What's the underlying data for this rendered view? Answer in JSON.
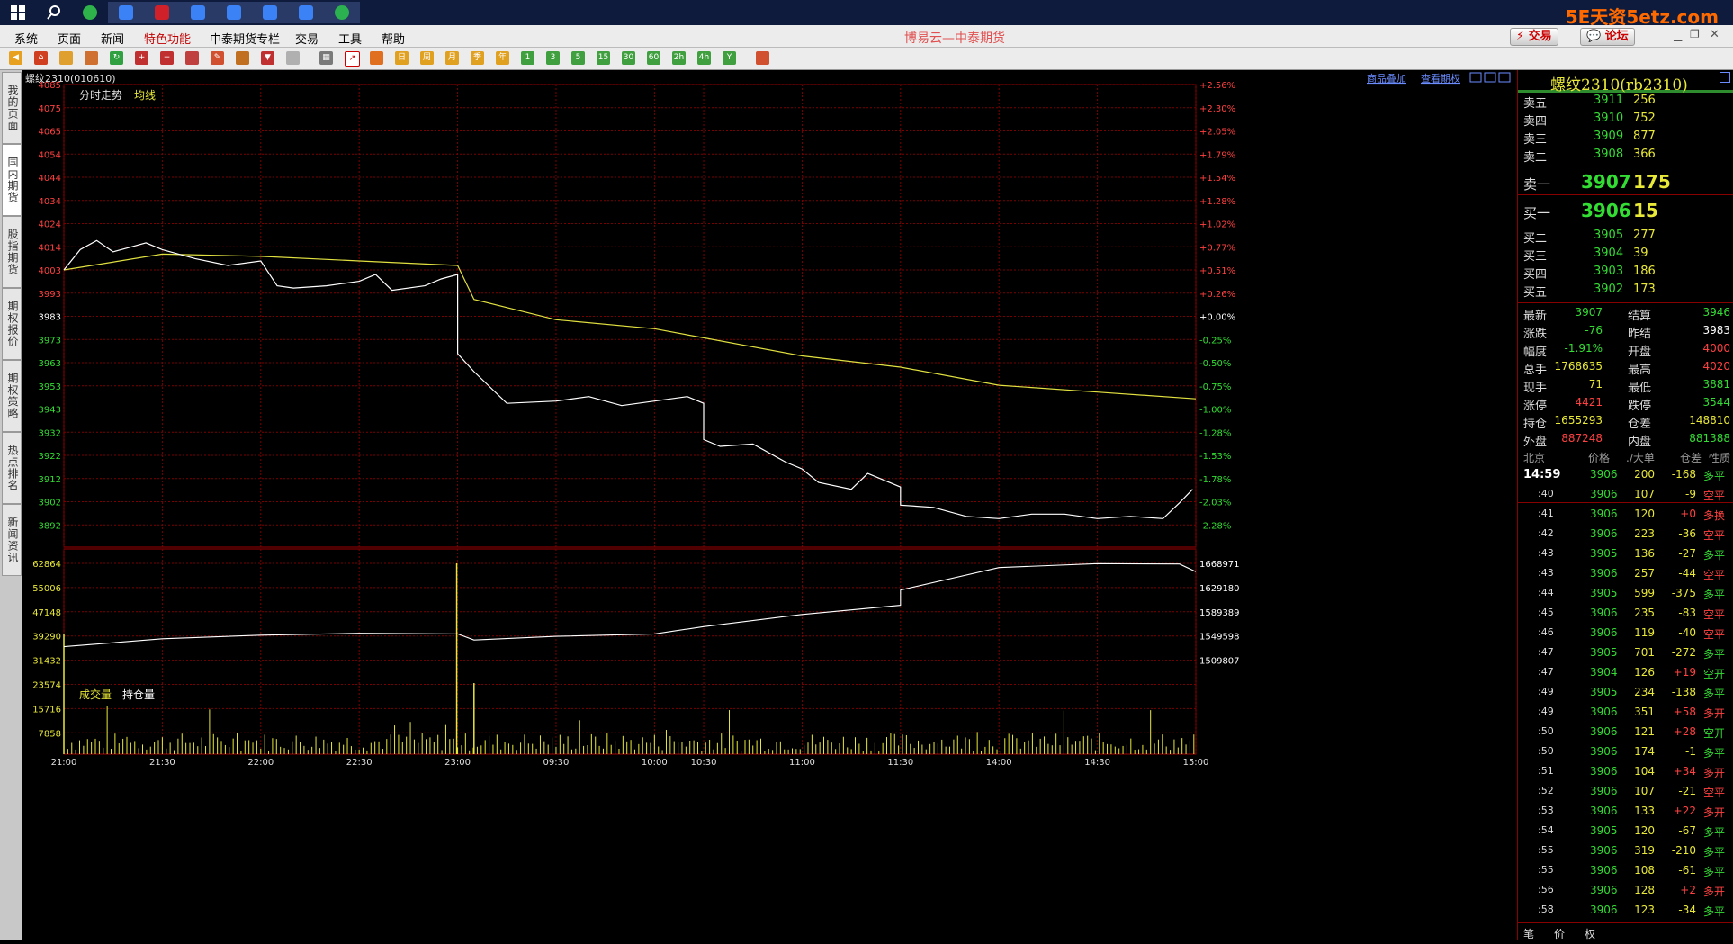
{
  "brand": "5E天资5etz.com",
  "menubar": {
    "items": [
      "系统",
      "页面",
      "新闻",
      "特色功能",
      "中泰期货专栏",
      "交易",
      "工具",
      "帮助"
    ],
    "title": "博易云—中泰期货",
    "trade_btn": "交易",
    "forum_btn": "论坛"
  },
  "left_nav": [
    "我的页面",
    "国内期货",
    "股指期货",
    "期权报价",
    "期权策略",
    "热点排名",
    "新闻资讯"
  ],
  "chart_header": {
    "symbol": "螺纹2310(010610)",
    "overlay_link": "商品叠加",
    "options_link": "查看期权"
  },
  "price_panel": {
    "label": "分时走势",
    "avg_label": "均线",
    "left_ticks": [
      "4085",
      "4075",
      "4065",
      "4054",
      "4044",
      "4034",
      "4024",
      "4014",
      "4003",
      "3993",
      "3983",
      "3973",
      "3963",
      "3953",
      "3943",
      "3932",
      "3922",
      "3912",
      "3902",
      "3892"
    ],
    "right_ticks": [
      "+2.56%",
      "+2.30%",
      "+2.05%",
      "+1.79%",
      "+1.54%",
      "+1.28%",
      "+1.02%",
      "+0.77%",
      "+0.51%",
      "+0.26%",
      "+0.00%",
      "-0.25%",
      "-0.50%",
      "-0.75%",
      "-1.00%",
      "-1.28%",
      "-1.53%",
      "-1.78%",
      "-2.03%",
      "-2.28%"
    ],
    "ymax": 4085,
    "ystep": 10.25,
    "price_color": "#ffffff",
    "avg_color": "#e0e040"
  },
  "volume_panel": {
    "vol_label": "成交量",
    "oi_label": "持仓量",
    "left_ticks": [
      "62864",
      "55006",
      "47148",
      "39290",
      "31432",
      "23574",
      "15716",
      "7858"
    ],
    "right_ticks": [
      "1668971",
      "1629180",
      "1589389",
      "1549598",
      "1509807"
    ],
    "vol_color": "#e8e838"
  },
  "time_axis": [
    "21:00",
    "21:30",
    "22:00",
    "22:30",
    "23:00",
    "09:30",
    "10:00",
    "10:30",
    "11:00",
    "11:30",
    "14:00",
    "14:30",
    "15:00"
  ],
  "chart_data": {
    "type": "line",
    "title": "螺纹2310(010610)",
    "xlabel": "",
    "ylabel": "",
    "ylim": [
      3887,
      4090
    ],
    "series": [
      {
        "name": "分时走势",
        "x": [
          "21:00",
          "21:05",
          "21:10",
          "21:15",
          "21:20",
          "21:25",
          "21:30",
          "21:40",
          "21:50",
          "22:00",
          "22:05",
          "22:10",
          "22:20",
          "22:30",
          "22:35",
          "22:40",
          "22:50",
          "22:55",
          "23:00",
          "09:00",
          "09:05",
          "09:15",
          "09:30",
          "09:40",
          "09:50",
          "10:00",
          "10:10",
          "10:15",
          "10:30",
          "10:35",
          "10:45",
          "10:55",
          "11:00",
          "11:05",
          "11:15",
          "11:20",
          "11:30",
          "13:30",
          "13:40",
          "13:50",
          "14:00",
          "14:10",
          "14:20",
          "14:30",
          "14:40",
          "14:50",
          "14:55",
          "14:59"
        ],
        "values": [
          4003,
          4012,
          4016,
          4011,
          4013,
          4015,
          4012,
          4008,
          4005,
          4007,
          3996,
          3995,
          3996,
          3998,
          4001,
          3994,
          3996,
          3999,
          4001,
          3966,
          3958,
          3944,
          3945,
          3947,
          3943,
          3945,
          3947,
          3944,
          3928,
          3925,
          3926,
          3918,
          3915,
          3909,
          3906,
          3913,
          3907,
          3899,
          3898,
          3894,
          3893,
          3895,
          3895,
          3893,
          3894,
          3893,
          3900,
          3906
        ]
      },
      {
        "name": "均线",
        "x": [
          "21:00",
          "21:30",
          "22:00",
          "22:30",
          "23:00",
          "09:05",
          "09:30",
          "10:00",
          "10:30",
          "11:00",
          "11:30",
          "14:00",
          "14:30",
          "15:00"
        ],
        "values": [
          4003,
          4010,
          4009,
          4007,
          4005,
          3990,
          3981,
          3977,
          3973,
          3965,
          3960,
          3952,
          3949,
          3946
        ]
      },
      {
        "name": "持仓量",
        "x": [
          "21:00",
          "21:30",
          "22:00",
          "22:30",
          "23:00",
          "09:05",
          "09:30",
          "10:00",
          "10:30",
          "11:00",
          "11:30",
          "13:30",
          "14:00",
          "14:30",
          "14:55",
          "15:00"
        ],
        "values": [
          1532000,
          1545000,
          1551000,
          1554000,
          1553000,
          1543000,
          1549000,
          1553000,
          1565000,
          1585000,
          1600000,
          1625000,
          1662000,
          1668500,
          1668000,
          1655293
        ]
      }
    ],
    "volume": {
      "peaks": [
        {
          "time": "23:00",
          "value": 62864
        },
        {
          "time": "21:00",
          "value": 40000
        },
        {
          "time": "09:05",
          "value": 24000
        }
      ],
      "typical": 7858
    }
  },
  "quote": {
    "title": "螺纹2310(rb2310)",
    "asks": [
      {
        "label": "卖五",
        "price": "3911",
        "vol": "256"
      },
      {
        "label": "卖四",
        "price": "3910",
        "vol": "752"
      },
      {
        "label": "卖三",
        "price": "3909",
        "vol": "877"
      },
      {
        "label": "卖二",
        "price": "3908",
        "vol": "366"
      },
      {
        "label": "卖一",
        "price": "3907",
        "vol": "175"
      }
    ],
    "bids": [
      {
        "label": "买一",
        "price": "3906",
        "vol": "15"
      },
      {
        "label": "买二",
        "price": "3905",
        "vol": "277"
      },
      {
        "label": "买三",
        "price": "3904",
        "vol": "39"
      },
      {
        "label": "买四",
        "price": "3903",
        "vol": "186"
      },
      {
        "label": "买五",
        "price": "3902",
        "vol": "173"
      }
    ],
    "stats": [
      {
        "l1": "最新",
        "v1": "3907",
        "c1": "#33dd33",
        "l2": "结算",
        "v2": "3946",
        "c2": "#33dd33"
      },
      {
        "l1": "涨跌",
        "v1": "-76",
        "c1": "#33dd33",
        "l2": "昨结",
        "v2": "3983",
        "c2": "#ffffff"
      },
      {
        "l1": "幅度",
        "v1": "-1.91%",
        "c1": "#33dd33",
        "l2": "开盘",
        "v2": "4000",
        "c2": "#ff4040"
      },
      {
        "l1": "总手",
        "v1": "1768635",
        "c1": "#e8e838",
        "l2": "最高",
        "v2": "4020",
        "c2": "#ff4040"
      },
      {
        "l1": "现手",
        "v1": "71",
        "c1": "#e8e838",
        "l2": "最低",
        "v2": "3881",
        "c2": "#33dd33"
      },
      {
        "l1": "涨停",
        "v1": "4421",
        "c1": "#ff4040",
        "l2": "跌停",
        "v2": "3544",
        "c2": "#33dd33"
      },
      {
        "l1": "持仓",
        "v1": "1655293",
        "c1": "#e8e838",
        "l2": "仓差",
        "v2": "148810",
        "c2": "#e8e838"
      },
      {
        "l1": "外盘",
        "v1": "887248",
        "c1": "#ff4040",
        "l2": "内盘",
        "v2": "881388",
        "c2": "#33dd33"
      }
    ],
    "tick_header": [
      "北京",
      "价格",
      "./大单",
      "仓差",
      "性质"
    ],
    "ticks": [
      {
        "t": "14:59",
        "p": "3906",
        "v": "200",
        "d": "-168",
        "k": "多平",
        "kc": "#33dd33"
      },
      {
        "t": ":40",
        "p": "3906",
        "v": "107",
        "d": "-9",
        "k": "空平",
        "kc": "#ff4040"
      },
      {
        "t": ":41",
        "p": "3906",
        "v": "120",
        "d": "+0",
        "k": "多换",
        "kc": "#ff4040"
      },
      {
        "t": ":42",
        "p": "3906",
        "v": "223",
        "d": "-36",
        "k": "空平",
        "kc": "#ff4040"
      },
      {
        "t": ":43",
        "p": "3905",
        "v": "136",
        "d": "-27",
        "k": "多平",
        "kc": "#33dd33"
      },
      {
        "t": ":43",
        "p": "3906",
        "v": "257",
        "d": "-44",
        "k": "空平",
        "kc": "#ff4040"
      },
      {
        "t": ":44",
        "p": "3905",
        "v": "599",
        "d": "-375",
        "k": "多平",
        "kc": "#33dd33"
      },
      {
        "t": ":45",
        "p": "3906",
        "v": "235",
        "d": "-83",
        "k": "空平",
        "kc": "#ff4040"
      },
      {
        "t": ":46",
        "p": "3906",
        "v": "119",
        "d": "-40",
        "k": "空平",
        "kc": "#ff4040"
      },
      {
        "t": ":47",
        "p": "3905",
        "v": "701",
        "d": "-272",
        "k": "多平",
        "kc": "#33dd33"
      },
      {
        "t": ":47",
        "p": "3904",
        "v": "126",
        "d": "+19",
        "k": "空开",
        "kc": "#33dd33"
      },
      {
        "t": ":49",
        "p": "3905",
        "v": "234",
        "d": "-138",
        "k": "多平",
        "kc": "#33dd33"
      },
      {
        "t": ":49",
        "p": "3906",
        "v": "351",
        "d": "+58",
        "k": "多开",
        "kc": "#ff4040"
      },
      {
        "t": ":50",
        "p": "3906",
        "v": "121",
        "d": "+28",
        "k": "空开",
        "kc": "#33dd33"
      },
      {
        "t": ":50",
        "p": "3906",
        "v": "174",
        "d": "-1",
        "k": "多平",
        "kc": "#33dd33"
      },
      {
        "t": ":51",
        "p": "3906",
        "v": "104",
        "d": "+34",
        "k": "多开",
        "kc": "#ff4040"
      },
      {
        "t": ":52",
        "p": "3906",
        "v": "107",
        "d": "-21",
        "k": "空平",
        "kc": "#ff4040"
      },
      {
        "t": ":53",
        "p": "3906",
        "v": "133",
        "d": "+22",
        "k": "多开",
        "kc": "#ff4040"
      },
      {
        "t": ":54",
        "p": "3905",
        "v": "120",
        "d": "-67",
        "k": "多平",
        "kc": "#33dd33"
      },
      {
        "t": ":55",
        "p": "3906",
        "v": "319",
        "d": "-210",
        "k": "多平",
        "kc": "#33dd33"
      },
      {
        "t": ":55",
        "p": "3906",
        "v": "108",
        "d": "-61",
        "k": "多平",
        "kc": "#33dd33"
      },
      {
        "t": ":56",
        "p": "3906",
        "v": "128",
        "d": "+2",
        "k": "多开",
        "kc": "#ff4040"
      },
      {
        "t": ":58",
        "p": "3906",
        "v": "123",
        "d": "-34",
        "k": "多平",
        "kc": "#33dd33"
      }
    ],
    "bottom_tabs": [
      "笔",
      "价",
      "权"
    ]
  }
}
